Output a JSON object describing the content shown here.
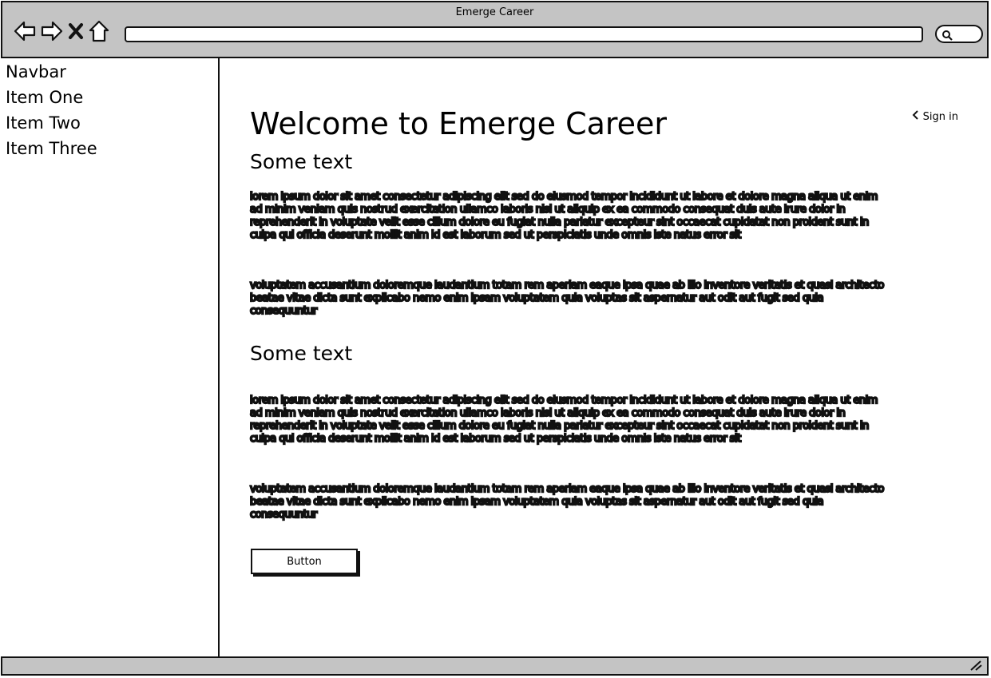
{
  "window": {
    "title": "Emerge Career"
  },
  "toolbar": {
    "back_icon": "back-arrow-icon",
    "forward_icon": "forward-arrow-icon",
    "stop_icon": "close-icon",
    "home_icon": "home-icon",
    "url_value": "",
    "search_icon": "search-icon"
  },
  "sidebar": {
    "items": [
      {
        "label": "Navbar"
      },
      {
        "label": "Item One"
      },
      {
        "label": "Item Two"
      },
      {
        "label": "Item Three"
      }
    ]
  },
  "main": {
    "heading": "Welcome to Emerge Career",
    "signin_label": "Sign in",
    "sections": [
      {
        "title": "Some text",
        "paragraphs": [
          "lorem ipsum dolor sit amet consectetur adipiscing elit sed do eiusmod tempor incididunt ut labore et dolore magna aliqua ut enim ad minim veniam quis nostrud exercitation ullamco laboris nisi ut aliquip ex ea commodo consequat duis aute irure dolor in reprehenderit in voluptate velit esse cillum dolore eu fugiat nulla pariatur excepteur sint occaecat cupidatat non proident sunt in culpa qui officia deserunt mollit anim id est laborum sed ut perspiciatis unde omnis iste natus error sit",
          "voluptatem accusantium doloremque laudantium totam rem aperiam eaque ipsa quae ab illo inventore veritatis et quasi architecto beatae vitae dicta sunt explicabo nemo enim ipsam voluptatem quia voluptas sit aspernatur aut odit aut fugit sed quia consequuntur"
        ]
      },
      {
        "title": "Some text",
        "paragraphs": [
          "lorem ipsum dolor sit amet consectetur adipiscing elit sed do eiusmod tempor incididunt ut labore et dolore magna aliqua ut enim ad minim veniam quis nostrud exercitation ullamco laboris nisi ut aliquip ex ea commodo consequat duis aute irure dolor in reprehenderit in voluptate velit esse cillum dolore eu fugiat nulla pariatur excepteur sint occaecat cupidatat non proident sunt in culpa qui officia deserunt mollit anim id est laborum sed ut perspiciatis unde omnis iste natus error sit",
          "voluptatem accusantium doloremque laudantium totam rem aperiam eaque ipsa quae ab illo inventore veritatis et quasi architecto beatae vitae dicta sunt explicabo nemo enim ipsam voluptatem quia voluptas sit aspernatur aut odit aut fugit sed quia consequuntur"
        ]
      }
    ],
    "button_label": "Button"
  },
  "statusbar": {
    "resize_icon": "resize-grip-icon"
  }
}
